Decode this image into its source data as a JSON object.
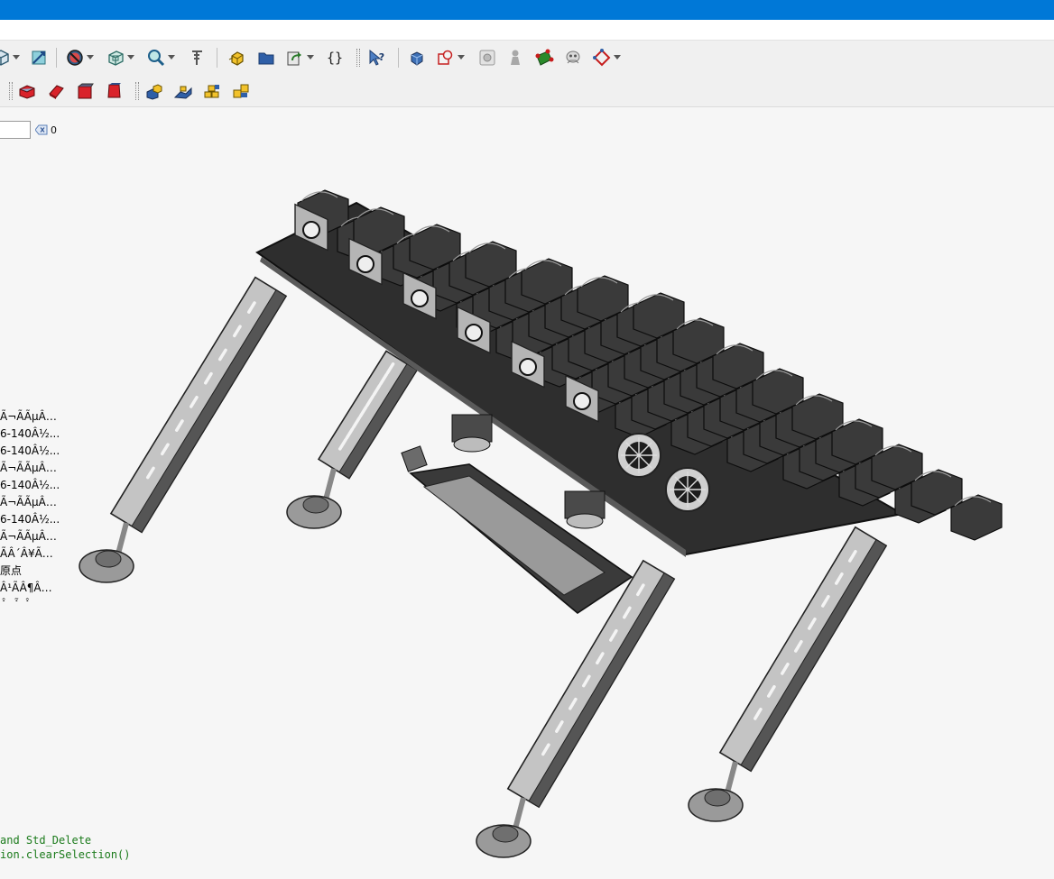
{
  "window": {
    "title_bar_color": "#0078d7"
  },
  "toolbar_row1": [
    {
      "name": "view-isometric-icon",
      "dropdown": true
    },
    {
      "name": "view-measure-icon",
      "dropdown": false
    },
    {
      "name": "draw-style-icon",
      "dropdown": true
    },
    {
      "name": "view-box-icon",
      "dropdown": true
    },
    {
      "name": "zoom-icon",
      "dropdown": true
    },
    {
      "name": "measure-ruler-icon",
      "dropdown": false
    },
    {
      "name": "part-icon",
      "dropdown": false
    },
    {
      "name": "folder-icon",
      "dropdown": false
    },
    {
      "name": "link-icon",
      "dropdown": true
    },
    {
      "name": "macro-braces-icon",
      "dropdown": false
    },
    {
      "name": "whats-this-icon",
      "dropdown": false
    },
    {
      "name": "part-design-icon",
      "dropdown": false
    },
    {
      "name": "clone-icon",
      "dropdown": true
    },
    {
      "name": "refine-icon",
      "dropdown": false
    },
    {
      "name": "figure-icon",
      "dropdown": false
    },
    {
      "name": "sketch-icon",
      "dropdown": false
    },
    {
      "name": "robot-icon",
      "dropdown": false
    },
    {
      "name": "datum-icon",
      "dropdown": true
    }
  ],
  "toolbar_row2": [
    {
      "name": "cube-red-icon"
    },
    {
      "name": "extrude-red-icon"
    },
    {
      "name": "box-red-icon"
    },
    {
      "name": "prism-red-icon"
    },
    {
      "name": "assembly-blocks-icon"
    },
    {
      "name": "assembly-stairs-icon"
    },
    {
      "name": "assembly-stack-icon"
    },
    {
      "name": "assembly-parts-icon"
    }
  ],
  "filter": {
    "value": "",
    "count": "0"
  },
  "tree_items": [
    "Ã¬Ã­ÃµÂ…",
    "6-140Â½...",
    "6-140Â½...",
    "Ã¬Ã­ÃµÂ…",
    "6-140Â½...",
    "Ã¬Ã­ÃµÂ…",
    "6-140Â½...",
    "Ã¬Ã­ÃµÂ…",
    "Ã­Â´Â¥Ã…",
    "原点",
    "Â¹Ã­Â¶Â…",
    "Â¸Ã Â¸"
  ],
  "console_lines": [
    "and Std_Delete",
    "ion.clearSelection()"
  ],
  "colors": {
    "toolbar_bg": "#f0f0f0",
    "viewport_bg": "#f6f6f6",
    "console_text": "#1a7a1a",
    "model_dark": "#3a3a3a",
    "model_light": "#c4c4c4"
  }
}
